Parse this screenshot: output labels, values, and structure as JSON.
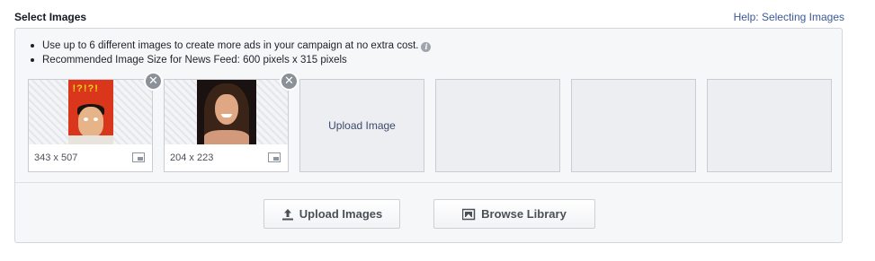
{
  "header": {
    "title": "Select Images",
    "help_link": "Help: Selecting Images"
  },
  "tips": [
    "Use up to 6 different images to create more ads in your campaign at no extra cost.",
    "Recommended Image Size for News Feed: 600 pixels x 315 pixels"
  ],
  "info_icon_glyph": "i",
  "slots": [
    {
      "state": "filled",
      "dimensions": "343 x 507",
      "photo": "man-with-question-marks"
    },
    {
      "state": "filled",
      "dimensions": "204 x 223",
      "photo": "smiling-woman"
    },
    {
      "state": "upload",
      "label": "Upload Image"
    },
    {
      "state": "empty"
    },
    {
      "state": "empty"
    },
    {
      "state": "empty"
    }
  ],
  "remove_glyph": "✕",
  "buttons": {
    "upload_images": "Upload Images",
    "browse_library": "Browse Library"
  },
  "colors": {
    "link": "#3b5998",
    "panel_bg": "#f6f7f9",
    "remove_badge": "#8b9199"
  }
}
